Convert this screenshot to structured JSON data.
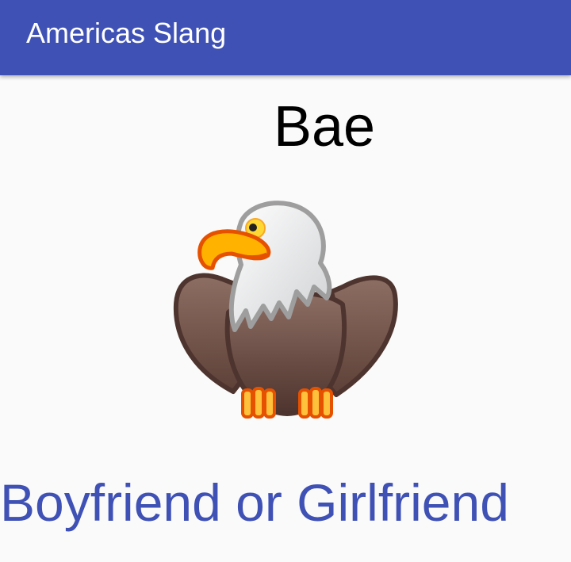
{
  "app_bar": {
    "title": "Americas Slang",
    "color": "#3f51b5"
  },
  "slang": {
    "word": "Bae",
    "meaning": "Boyfriend or Girlfriend",
    "meaning_color": "#3f51b5",
    "illustration_icon": "eagle-icon"
  }
}
